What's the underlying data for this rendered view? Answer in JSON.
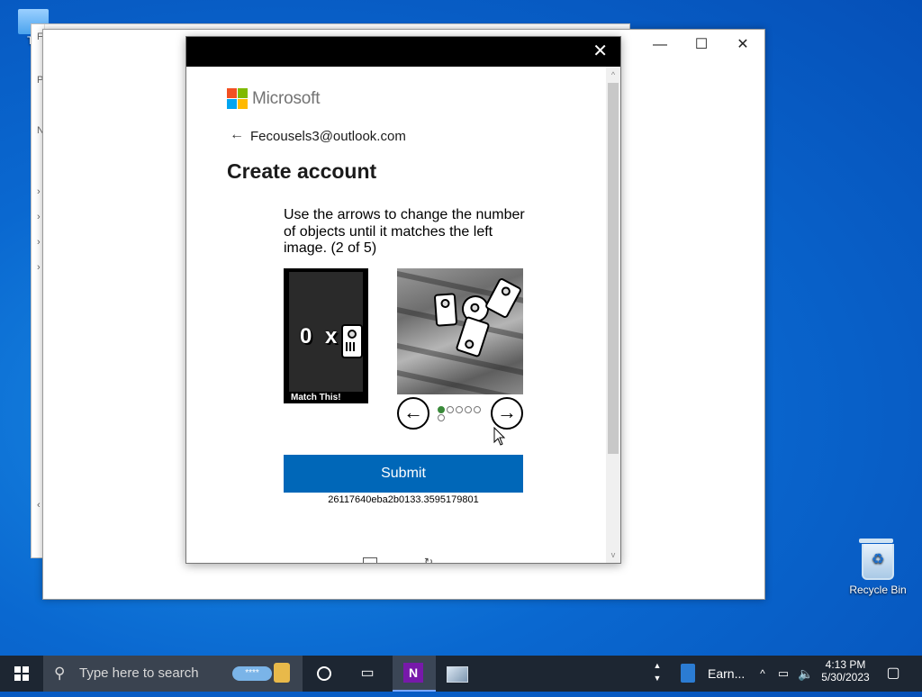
{
  "desktop": {
    "recycle_bin_label": "Recycle Bin",
    "top_left_fragment": "Th"
  },
  "background_window": {
    "fragments": [
      "F",
      "P",
      "N"
    ]
  },
  "main_window": {
    "minimize": "—",
    "maximize": "☐",
    "close": "✕"
  },
  "dialog": {
    "close_glyph": "✕",
    "brand": "Microsoft",
    "back_glyph": "←",
    "email": "Fecousels3@outlook.com",
    "title": "Create account",
    "instruction": "Use the arrows to change the number of objects until it matches the left image. (2 of 5)",
    "left_image": {
      "count_text": "0 x",
      "caption": "Match This!"
    },
    "nav": {
      "prev_glyph": "←",
      "next_glyph": "→",
      "dots_total": 6,
      "active_dot": 1
    },
    "submit_label": "Submit",
    "session_id": "26117640eba2b0133.3595179801",
    "colors": {
      "submit_bg": "#0067b8",
      "ms_red": "#f25022",
      "ms_green": "#7fba00",
      "ms_blue": "#00a4ef",
      "ms_yellow": "#ffb900"
    }
  },
  "taskbar": {
    "start_icon": "windows-logo",
    "search_placeholder": "Type here to search",
    "app_label": "Earn...",
    "time": "4:13 PM",
    "date": "5/30/2023"
  }
}
